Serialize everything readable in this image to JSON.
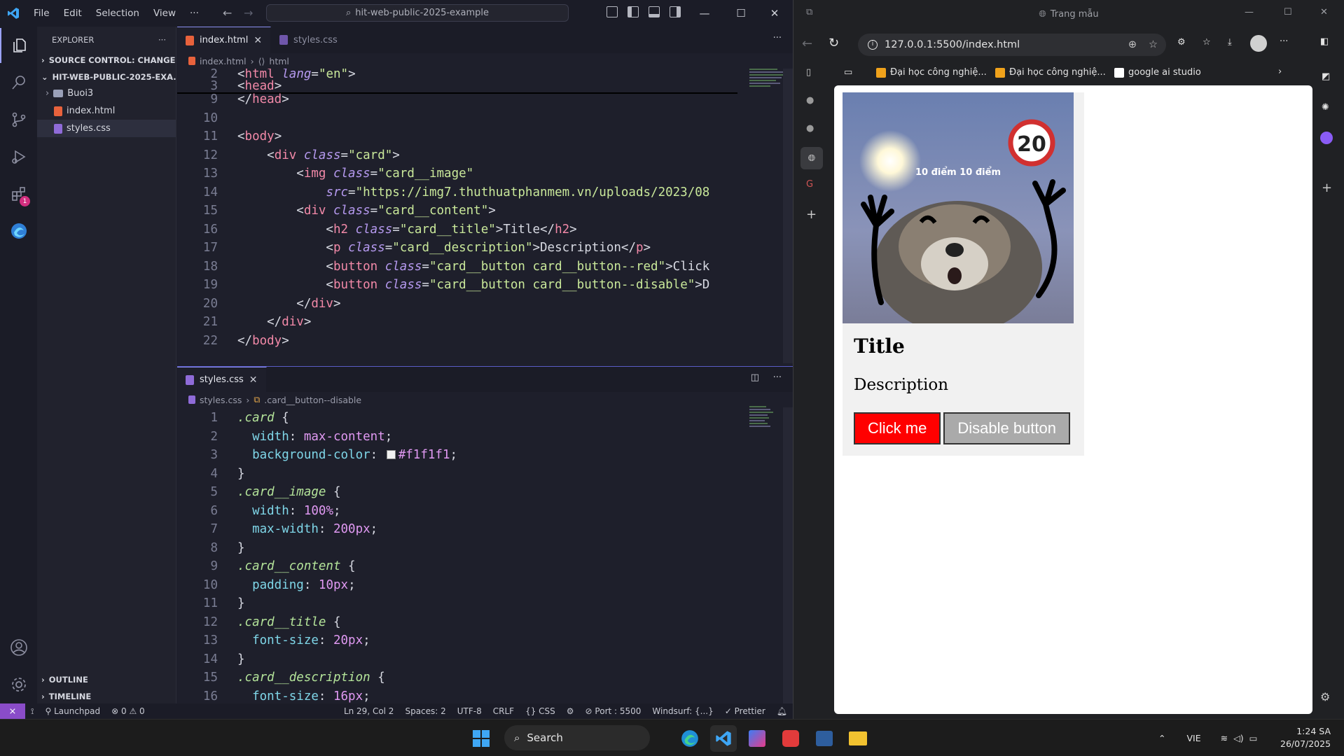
{
  "vscode": {
    "menu": [
      "File",
      "Edit",
      "Selection",
      "View",
      "···"
    ],
    "command_center": "hit-web-public-2025-example",
    "explorer": {
      "title": "EXPLORER",
      "source_control": "SOURCE CONTROL: CHANGES",
      "project": "HIT-WEB-PUBLIC-2025-EXA...",
      "items": [
        {
          "label": "Buoi3",
          "type": "folder"
        },
        {
          "label": "index.html",
          "type": "html"
        },
        {
          "label": "styles.css",
          "type": "css"
        }
      ],
      "outline": "OUTLINE",
      "timeline": "TIMELINE"
    },
    "extensions_badge": "1",
    "editor_top": {
      "tabs": [
        {
          "label": "index.html",
          "active": true
        },
        {
          "label": "styles.css",
          "active": false
        }
      ],
      "breadcrumb": [
        "index.html",
        "html"
      ],
      "sticky": [
        {
          "n": "2",
          "segs": [
            [
              "pu",
              "<"
            ],
            [
              "tg",
              "html"
            ],
            [
              "pu",
              " "
            ],
            [
              "at",
              "lang"
            ],
            [
              "pu",
              "="
            ],
            [
              "st",
              "\"en\""
            ],
            [
              "pu",
              ">"
            ]
          ]
        },
        {
          "n": "3",
          "segs": [
            [
              "pu",
              "<"
            ],
            [
              "tg",
              "head"
            ],
            [
              "pu",
              ">"
            ]
          ]
        }
      ],
      "lines": [
        {
          "n": "9",
          "segs": [
            [
              "pu",
              "</"
            ],
            [
              "tg",
              "head"
            ],
            [
              "pu",
              ">"
            ]
          ]
        },
        {
          "n": "10",
          "segs": []
        },
        {
          "n": "11",
          "segs": [
            [
              "pu",
              "<"
            ],
            [
              "tg",
              "body"
            ],
            [
              "pu",
              ">"
            ]
          ]
        },
        {
          "n": "12",
          "segs": [
            [
              "pu",
              "    <"
            ],
            [
              "tg",
              "div"
            ],
            [
              "pu",
              " "
            ],
            [
              "at",
              "class"
            ],
            [
              "pu",
              "="
            ],
            [
              "st",
              "\"card\""
            ],
            [
              "pu",
              ">"
            ]
          ]
        },
        {
          "n": "13",
          "segs": [
            [
              "pu",
              "        <"
            ],
            [
              "tg",
              "img"
            ],
            [
              "pu",
              " "
            ],
            [
              "at",
              "class"
            ],
            [
              "pu",
              "="
            ],
            [
              "st",
              "\"card__image\""
            ]
          ]
        },
        {
          "n": "14",
          "segs": [
            [
              "pu",
              "            "
            ],
            [
              "at",
              "src"
            ],
            [
              "pu",
              "="
            ],
            [
              "st",
              "\"https://img7.thuthuatphanmem.vn/uploads/2023/08"
            ]
          ]
        },
        {
          "n": "15",
          "segs": [
            [
              "pu",
              "        <"
            ],
            [
              "tg",
              "div"
            ],
            [
              "pu",
              " "
            ],
            [
              "at",
              "class"
            ],
            [
              "pu",
              "="
            ],
            [
              "st",
              "\"card__content\""
            ],
            [
              "pu",
              ">"
            ]
          ]
        },
        {
          "n": "16",
          "segs": [
            [
              "pu",
              "            <"
            ],
            [
              "tg",
              "h2"
            ],
            [
              "pu",
              " "
            ],
            [
              "at",
              "class"
            ],
            [
              "pu",
              "="
            ],
            [
              "st",
              "\"card__title\""
            ],
            [
              "pu",
              ">Title</"
            ],
            [
              "tg",
              "h2"
            ],
            [
              "pu",
              ">"
            ]
          ]
        },
        {
          "n": "17",
          "segs": [
            [
              "pu",
              "            <"
            ],
            [
              "tg",
              "p"
            ],
            [
              "pu",
              " "
            ],
            [
              "at",
              "class"
            ],
            [
              "pu",
              "="
            ],
            [
              "st",
              "\"card__description\""
            ],
            [
              "pu",
              ">Description</"
            ],
            [
              "tg",
              "p"
            ],
            [
              "pu",
              ">"
            ]
          ]
        },
        {
          "n": "18",
          "segs": [
            [
              "pu",
              "            <"
            ],
            [
              "tg",
              "button"
            ],
            [
              "pu",
              " "
            ],
            [
              "at",
              "class"
            ],
            [
              "pu",
              "="
            ],
            [
              "st",
              "\"card__button card__button--red\""
            ],
            [
              "pu",
              ">Click"
            ]
          ]
        },
        {
          "n": "19",
          "segs": [
            [
              "pu",
              "            <"
            ],
            [
              "tg",
              "button"
            ],
            [
              "pu",
              " "
            ],
            [
              "at",
              "class"
            ],
            [
              "pu",
              "="
            ],
            [
              "st",
              "\"card__button card__button--disable\""
            ],
            [
              "pu",
              ">D"
            ]
          ]
        },
        {
          "n": "20",
          "segs": [
            [
              "pu",
              "        </"
            ],
            [
              "tg",
              "div"
            ],
            [
              "pu",
              ">"
            ]
          ]
        },
        {
          "n": "21",
          "segs": [
            [
              "pu",
              "    </"
            ],
            [
              "tg",
              "div"
            ],
            [
              "pu",
              ">"
            ]
          ]
        },
        {
          "n": "22",
          "segs": [
            [
              "pu",
              "</"
            ],
            [
              "tg",
              "body"
            ],
            [
              "pu",
              ">"
            ]
          ]
        }
      ]
    },
    "editor_bottom": {
      "tab": "styles.css",
      "breadcrumb": [
        "styles.css",
        ".card__button--disable"
      ],
      "lines": [
        {
          "n": "1",
          "segs": [
            [
              "cls",
              ".card"
            ],
            [
              "pu",
              " {"
            ]
          ]
        },
        {
          "n": "2",
          "segs": [
            [
              "pu",
              "  "
            ],
            [
              "prop",
              "width"
            ],
            [
              "pu",
              ": "
            ],
            [
              "num",
              "max-content"
            ],
            [
              "pu",
              ";"
            ]
          ]
        },
        {
          "n": "3",
          "segs": [
            [
              "pu",
              "  "
            ],
            [
              "prop",
              "background-color"
            ],
            [
              "pu",
              ": "
            ],
            [
              "swatch",
              "#f1f1f1"
            ],
            [
              "num",
              "#f1f1f1"
            ],
            [
              "pu",
              ";"
            ]
          ]
        },
        {
          "n": "4",
          "segs": [
            [
              "pu",
              "}"
            ]
          ]
        },
        {
          "n": "5",
          "segs": [
            [
              "cls",
              ".card__image"
            ],
            [
              "pu",
              " {"
            ]
          ]
        },
        {
          "n": "6",
          "segs": [
            [
              "pu",
              "  "
            ],
            [
              "prop",
              "width"
            ],
            [
              "pu",
              ": "
            ],
            [
              "num",
              "100%"
            ],
            [
              "pu",
              ";"
            ]
          ]
        },
        {
          "n": "7",
          "segs": [
            [
              "pu",
              "  "
            ],
            [
              "prop",
              "max-width"
            ],
            [
              "pu",
              ": "
            ],
            [
              "num",
              "200px"
            ],
            [
              "pu",
              ";"
            ]
          ]
        },
        {
          "n": "8",
          "segs": [
            [
              "pu",
              "}"
            ]
          ]
        },
        {
          "n": "9",
          "segs": [
            [
              "cls",
              ".card__content"
            ],
            [
              "pu",
              " {"
            ]
          ]
        },
        {
          "n": "10",
          "segs": [
            [
              "pu",
              "  "
            ],
            [
              "prop",
              "padding"
            ],
            [
              "pu",
              ": "
            ],
            [
              "num",
              "10px"
            ],
            [
              "pu",
              ";"
            ]
          ]
        },
        {
          "n": "11",
          "segs": [
            [
              "pu",
              "}"
            ]
          ]
        },
        {
          "n": "12",
          "segs": [
            [
              "cls",
              ".card__title"
            ],
            [
              "pu",
              " {"
            ]
          ]
        },
        {
          "n": "13",
          "segs": [
            [
              "pu",
              "  "
            ],
            [
              "prop",
              "font-size"
            ],
            [
              "pu",
              ": "
            ],
            [
              "num",
              "20px"
            ],
            [
              "pu",
              ";"
            ]
          ]
        },
        {
          "n": "14",
          "segs": [
            [
              "pu",
              "}"
            ]
          ]
        },
        {
          "n": "15",
          "segs": [
            [
              "cls",
              ".card__description"
            ],
            [
              "pu",
              " {"
            ]
          ]
        },
        {
          "n": "16",
          "segs": [
            [
              "pu",
              "  "
            ],
            [
              "prop",
              "font-size"
            ],
            [
              "pu",
              ": "
            ],
            [
              "num",
              "16px"
            ],
            [
              "pu",
              ";"
            ]
          ]
        }
      ]
    },
    "status": {
      "launchpad": "Launchpad",
      "errors": "0",
      "warnings": "0",
      "position": "Ln 29, Col 2",
      "spaces": "Spaces: 2",
      "encoding": "UTF-8",
      "eol": "CRLF",
      "language": "CSS",
      "port": "Port : 5500",
      "windsurf": "Windsurf: {...}",
      "prettier": "Prettier"
    }
  },
  "browser": {
    "title": "Trang mẫu",
    "url": "127.0.0.1:5500/index.html",
    "bookmarks": [
      "Đại học công nghiệ...",
      "Đại học công nghiệ...",
      "google ai studio"
    ],
    "page": {
      "image_caption": "10 điểm 10 điểm",
      "sign_number": "20",
      "title": "Title",
      "description": "Description",
      "button_primary": "Click me",
      "button_disabled": "Disable button"
    }
  },
  "taskbar": {
    "search": "Search",
    "language": "VIE",
    "time": "1:24 SA",
    "date": "26/07/2025"
  },
  "colors": {
    "accent": "#8b8ff0",
    "button_red": "#ff0000",
    "button_disabled": "#aaaaaa",
    "card_bg": "#f1f1f1"
  }
}
